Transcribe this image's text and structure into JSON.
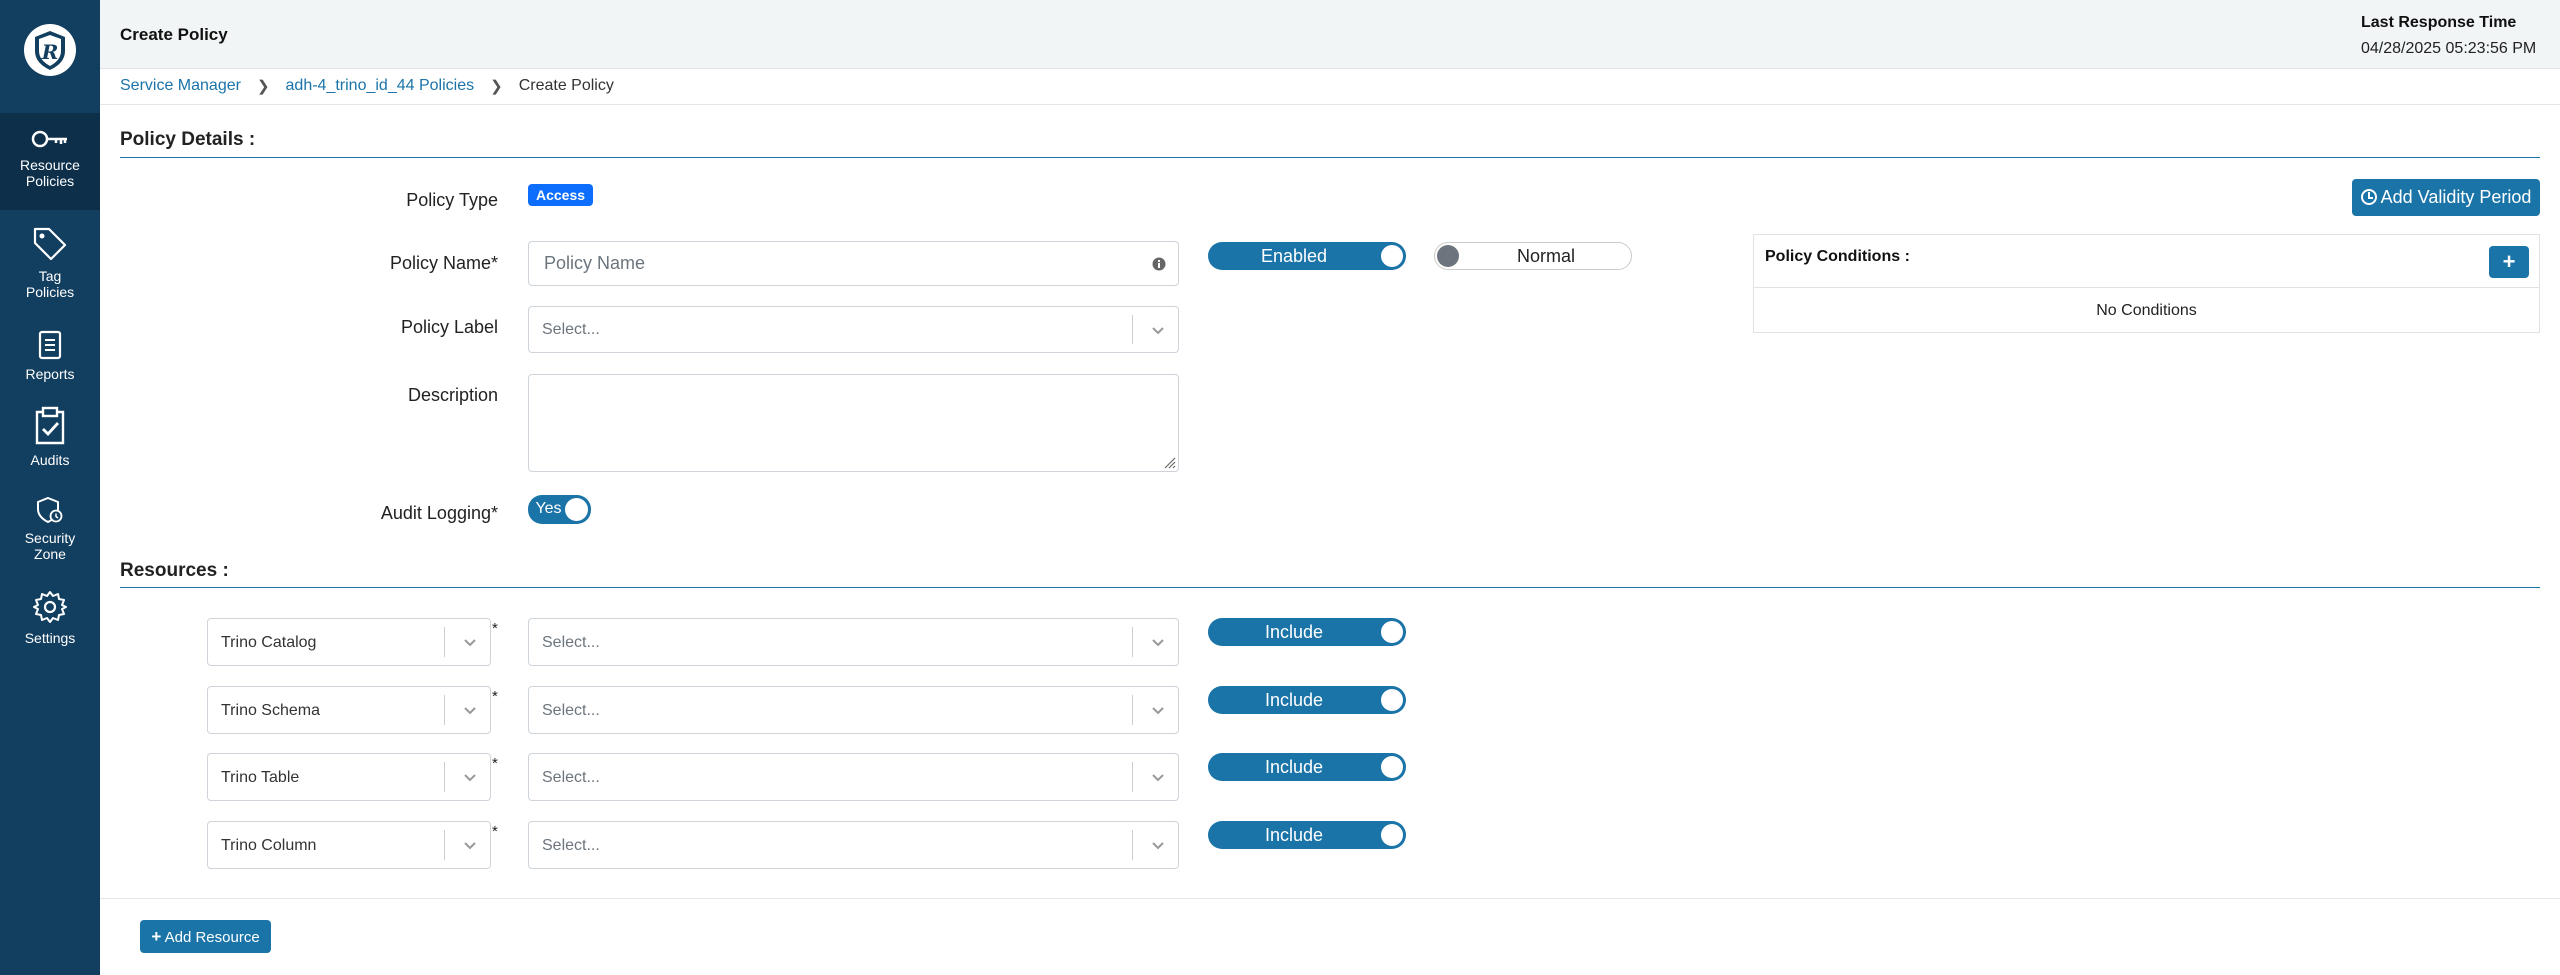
{
  "sidebar": {
    "items": [
      {
        "label_line1": "Resource",
        "label_line2": "Policies",
        "icon": "key-icon",
        "active": true
      },
      {
        "label_line1": "Tag",
        "label_line2": "Policies",
        "icon": "tag-icon"
      },
      {
        "label_line1": "Reports",
        "label_line2": "",
        "icon": "report-icon"
      },
      {
        "label_line1": "Audits",
        "label_line2": "",
        "icon": "clipboard-check-icon"
      },
      {
        "label_line1": "Security",
        "label_line2": "Zone",
        "icon": "shield-zone-icon"
      },
      {
        "label_line1": "Settings",
        "label_line2": "",
        "icon": "gear-icon"
      }
    ]
  },
  "header": {
    "title": "Create Policy",
    "response_label": "Last Response Time",
    "response_time": "04/28/2025 05:23:56 PM"
  },
  "breadcrumb": {
    "items": [
      "Service Manager",
      "adh-4_trino_id_44 Policies",
      "Create Policy"
    ]
  },
  "policy_details": {
    "section_title": "Policy Details :",
    "policy_type_label": "Policy Type",
    "policy_type_value": "Access",
    "add_validity_label": "Add Validity Period",
    "policy_name_label": "Policy Name*",
    "policy_name_placeholder": "Policy Name",
    "enabled_label": "Enabled",
    "normal_label": "Normal",
    "policy_label_label": "Policy Label",
    "policy_label_placeholder": "Select...",
    "description_label": "Description",
    "audit_logging_label": "Audit Logging*",
    "audit_logging_value": "Yes"
  },
  "conditions": {
    "title": "Policy Conditions :",
    "add_label": "+",
    "empty": "No Conditions"
  },
  "resources": {
    "section_title": "Resources :",
    "rows": [
      {
        "type": "Trino Catalog",
        "required": "*",
        "placeholder": "Select...",
        "include": "Include"
      },
      {
        "type": "Trino Schema",
        "required": "*",
        "placeholder": "Select...",
        "include": "Include"
      },
      {
        "type": "Trino Table",
        "required": "*",
        "placeholder": "Select...",
        "include": "Include"
      },
      {
        "type": "Trino Column",
        "required": "*",
        "placeholder": "Select...",
        "include": "Include"
      }
    ],
    "add_resource_label": "Add Resource"
  },
  "colors": {
    "sidebar": "#123e5f",
    "accent": "#1a74a8",
    "badge": "#0d6efd"
  }
}
